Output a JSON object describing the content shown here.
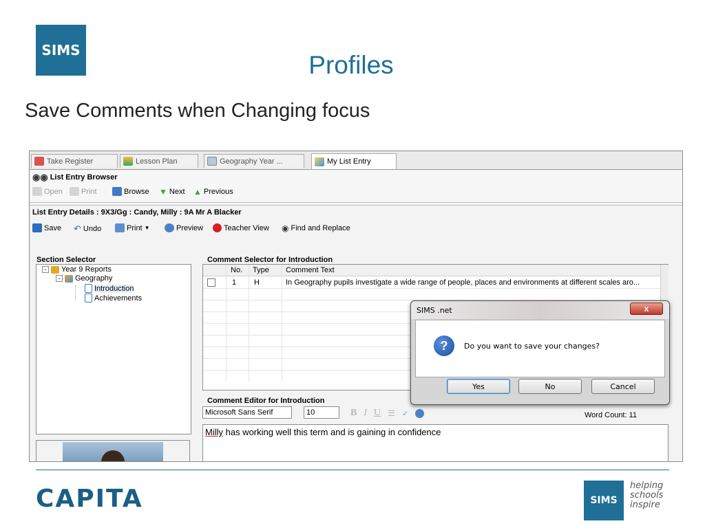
{
  "slide": {
    "logo": "SIMS",
    "title": "Profiles",
    "subtitle": "Save Comments when Changing focus",
    "footer_brand": "CAPITA",
    "footer_logo": "SIMS",
    "tagline": [
      "helping",
      "schools",
      "inspire"
    ]
  },
  "colors": {
    "brand": "#1f6f96",
    "dialog_close": "#c0392b",
    "help_icon": "#1a4f9c"
  },
  "tabs": [
    {
      "label": "Take Register",
      "icon": "register-icon"
    },
    {
      "label": "Lesson Plan",
      "icon": "lesson-plan-icon"
    },
    {
      "label": "Geography Year ...",
      "icon": "document-icon"
    },
    {
      "label": "My List Entry",
      "icon": "list-entry-icon"
    }
  ],
  "browser": {
    "title": "List Entry Browser",
    "toolbar": {
      "open": "Open",
      "print": "Print",
      "browse": "Browse",
      "next": "Next",
      "previous": "Previous"
    }
  },
  "details": {
    "title": "List Entry Details : 9X3/Gg  :  Candy, Milly  :  9A Mr A Blacker",
    "toolbar": {
      "save": "Save",
      "undo": "Undo",
      "print": "Print",
      "preview": "Preview",
      "teacher_view": "Teacher View",
      "find_replace": "Find and Replace"
    }
  },
  "section_selector": {
    "title": "Section Selector",
    "tree": {
      "root": "Year 9 Reports",
      "subject": "Geography",
      "items": [
        "Introduction",
        "Achievements"
      ]
    }
  },
  "comment_selector": {
    "title": "Comment Selector for Introduction",
    "headers": {
      "no": "No.",
      "type": "Type",
      "text": "Comment Text"
    },
    "rows": [
      {
        "no": "1",
        "type": "H",
        "text": "In Geography pupils investigate a wide range of people, places and environments at different scales aro..."
      }
    ]
  },
  "comment_editor": {
    "title": "Comment Editor for Introduction",
    "font": "Microsoft Sans Serif",
    "size": "10",
    "format": {
      "bold": "B",
      "italic": "I",
      "underline": "U"
    },
    "word_count": "Word Count: 11",
    "text_first": "Milly",
    "text_rest": " has working well this term and is gaining in confidence"
  },
  "dialog": {
    "title": "SIMS .net",
    "close": "x",
    "icon": "?",
    "message": "Do you want to save your changes?",
    "yes": "Yes",
    "no": "No",
    "cancel": "Cancel"
  }
}
